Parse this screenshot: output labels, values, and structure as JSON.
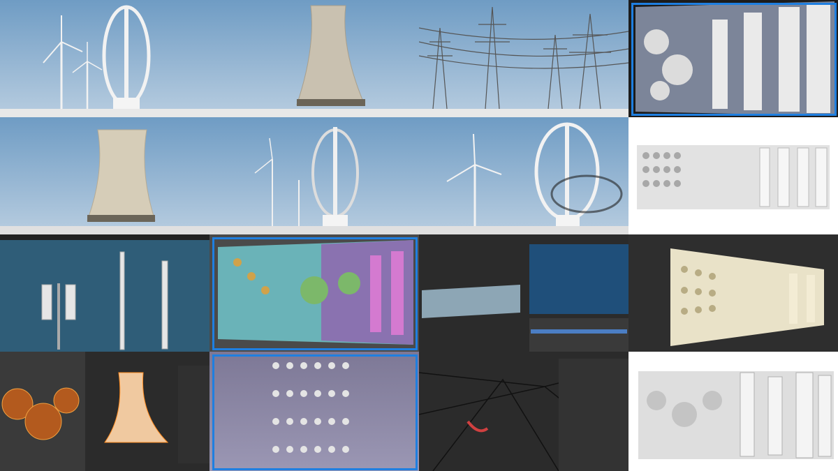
{
  "collage": {
    "tiles": [
      {
        "name": "tile-wind-turbines-sky",
        "subject": "wind-turbine-icon"
      },
      {
        "name": "tile-cooling-tower-sky",
        "subject": "cooling-tower-icon"
      },
      {
        "name": "tile-power-pylons-sky",
        "subject": "pylon-icon"
      },
      {
        "name": "tile-ornament-wall-framed",
        "subject": "relief-panel-icon"
      },
      {
        "name": "tile-cooling-tower-2",
        "subject": "cooling-tower-icon"
      },
      {
        "name": "tile-vertical-turbine",
        "subject": "wind-turbine-icon"
      },
      {
        "name": "tile-turbines-shadow",
        "subject": "wind-turbine-icon"
      },
      {
        "name": "tile-ornament-kit-white",
        "subject": "relief-panel-icon"
      },
      {
        "name": "tile-blender-turbine-poles",
        "subject": "editor-viewport-icon"
      },
      {
        "name": "tile-blender-colored-ornaments",
        "subject": "editor-viewport-icon"
      },
      {
        "name": "tile-blender-outliner",
        "subject": "editor-viewport-icon"
      },
      {
        "name": "tile-ornament-perspective",
        "subject": "relief-panel-icon"
      },
      {
        "name": "tile-uv-editor-tower",
        "subject": "editor-viewport-icon"
      },
      {
        "name": "tile-ornament-grid-purple",
        "subject": "relief-panel-icon"
      },
      {
        "name": "tile-pylon-wireframe",
        "subject": "editor-viewport-icon"
      },
      {
        "name": "tile-ornament-columns-white",
        "subject": "relief-panel-icon"
      }
    ],
    "accent_frame": "#1f7fe0",
    "sky_top": "#6f9cc4",
    "sky_bottom": "#b8cde0"
  }
}
